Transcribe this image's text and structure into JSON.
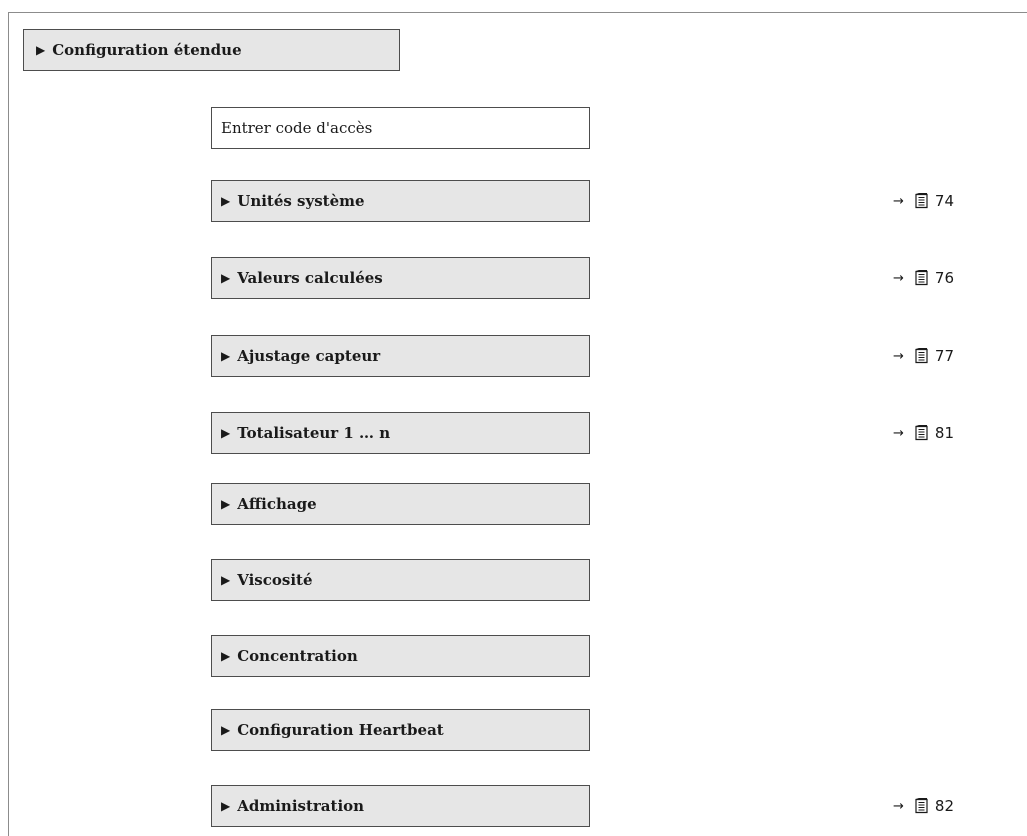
{
  "header": {
    "title": "Configuration étendue",
    "marker": "▶"
  },
  "items": [
    {
      "label": "Entrer code d'accès",
      "kind": "parameter",
      "marker": "",
      "ref_arrow": "",
      "ref_page": ""
    },
    {
      "label": "Unités système",
      "kind": "submenu",
      "marker": "▶",
      "ref_arrow": "→",
      "ref_page": "74"
    },
    {
      "label": "Valeurs calculées",
      "kind": "submenu",
      "marker": "▶",
      "ref_arrow": "→",
      "ref_page": "76"
    },
    {
      "label": "Ajustage capteur",
      "kind": "submenu",
      "marker": "▶",
      "ref_arrow": "→",
      "ref_page": "77"
    },
    {
      "label": "Totalisateur 1 … n",
      "kind": "submenu",
      "marker": "▶",
      "ref_arrow": "→",
      "ref_page": "81"
    },
    {
      "label": "Affichage",
      "kind": "submenu",
      "marker": "▶",
      "ref_arrow": "",
      "ref_page": ""
    },
    {
      "label": "Viscosité",
      "kind": "submenu",
      "marker": "▶",
      "ref_arrow": "",
      "ref_page": ""
    },
    {
      "label": "Concentration",
      "kind": "submenu",
      "marker": "▶",
      "ref_arrow": "",
      "ref_page": ""
    },
    {
      "label": "Configuration Heartbeat",
      "kind": "submenu",
      "marker": "▶",
      "ref_arrow": "",
      "ref_page": ""
    },
    {
      "label": "Administration",
      "kind": "submenu",
      "marker": "▶",
      "ref_arrow": "→",
      "ref_page": "82"
    }
  ],
  "icons": {
    "page_reference": "book-page-icon"
  }
}
